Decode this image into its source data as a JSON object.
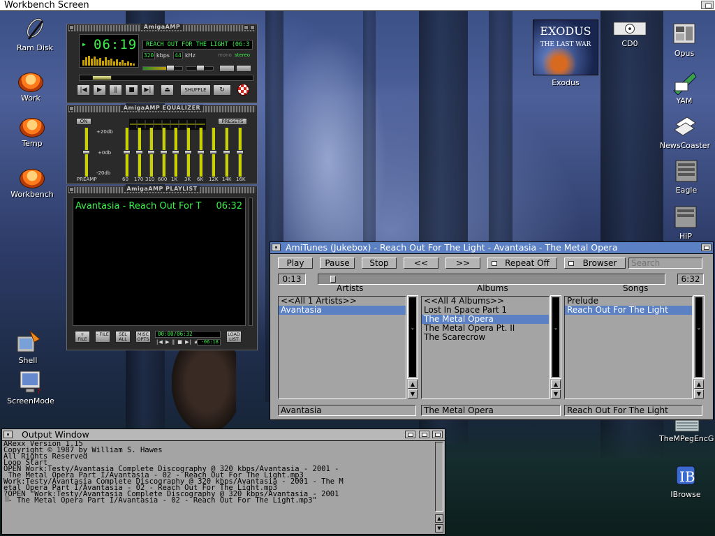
{
  "screen": {
    "title": "Workbench Screen"
  },
  "desktop_icons_left": [
    {
      "label": "Ram Disk",
      "icon": "ram-disk-icon"
    },
    {
      "label": "Work",
      "icon": "hard-disk-icon"
    },
    {
      "label": "Temp",
      "icon": "hard-disk-icon"
    },
    {
      "label": "Workbench",
      "icon": "hard-disk-icon"
    },
    {
      "label": "Shell",
      "icon": "shell-icon"
    },
    {
      "label": "ScreenMode",
      "icon": "screenmode-icon"
    }
  ],
  "desktop_icons_right": [
    {
      "label": "Exodus",
      "icon": "exodus-cover-icon"
    },
    {
      "label": "CD0",
      "icon": "cd-drive-icon"
    },
    {
      "label": "Opus",
      "icon": "opus-icon"
    },
    {
      "label": "YAM",
      "icon": "yam-mail-icon"
    },
    {
      "label": "NewsCoaster",
      "icon": "newscoaster-icon"
    },
    {
      "label": "Eagle",
      "icon": "eagle-icon"
    },
    {
      "label": "HiP",
      "icon": "hip-icon"
    },
    {
      "label": "TheMPegEncG",
      "icon": "mpeg-encoder-icon"
    },
    {
      "label": "IBrowse",
      "icon": "ibrowse-icon"
    }
  ],
  "exodus_cover": {
    "line1": "EXODUS",
    "line2": "THE LAST WAR"
  },
  "amigaamp": {
    "player_title": "AmigaAMP",
    "time": "06:19",
    "scroll_title": "REACH OUT FOR THE LIGHT (06:3",
    "kbps": "320",
    "kbps_unit": "kbps",
    "khz": "44",
    "khz_unit": "kHz",
    "mono": "mono",
    "stereo": "stereo",
    "shuffle": "SHUFFLE",
    "equalizer_title": "AmigaAMP EQUALIZER",
    "eq_on": "ON",
    "eq_presets": "PRESETS",
    "eq_db_top": "+20db",
    "eq_db_mid": "+0db",
    "eq_db_bottom": "-20db",
    "eq_bands": [
      "PREAMP",
      "60",
      "170",
      "310",
      "600",
      "1K",
      "3K",
      "6K",
      "12K",
      "14K",
      "16K"
    ],
    "eq_levels": [
      0.5,
      0.5,
      0.5,
      0.5,
      0.5,
      0.5,
      0.5,
      0.5,
      0.5,
      0.5,
      0.5
    ],
    "playlist_title": "AmigaAMP PLAYLIST",
    "playlist_entry": "Avantasia - Reach Out For T",
    "playlist_entry_time": "06:32",
    "pl_buttons": [
      "+ FILE",
      "- FILE",
      "SEL ALL",
      "MISC OPTS",
      "LOAD LIST"
    ],
    "pl_time": "00:00/06:32",
    "pl_remaining": "-06:18",
    "seek_progress": 0.08,
    "volume_level": 0.72,
    "balance_level": 0.5
  },
  "amitunes": {
    "title": "AmiTunes (Jukebox) - Reach Out For The Light - Avantasia - The Metal Opera",
    "buttons": {
      "play": "Play",
      "pause": "Pause",
      "stop": "Stop",
      "prev": "<<",
      "next": ">>",
      "repeat": "Repeat Off",
      "browser": "Browser"
    },
    "search_placeholder": "Search",
    "time_elapsed": "0:13",
    "time_total": "6:32",
    "progress": 0.03,
    "columns": {
      "artists": "Artists",
      "albums": "Albums",
      "songs": "Songs"
    },
    "artists": [
      "<<All 1 Artists>>",
      "Avantasia"
    ],
    "albums": [
      "<<All 4 Albums>>",
      "Lost In Space Part 1",
      "The Metal Opera",
      "The Metal Opera Pt. II",
      "The Scarecrow"
    ],
    "songs": [
      "Prelude",
      "Reach Out For The Light"
    ],
    "selected": {
      "artist": "Avantasia",
      "album": "The Metal Opera",
      "song": "Reach Out For The Light"
    }
  },
  "output": {
    "title": "Output Window",
    "lines": "ARexx Version 1.15\nCopyright © 1987 by William S. Hawes\nAll Rights Reserved\nLoop Start\nOPEN Work:Testy/Avantasia Complete Discography @ 320 kbps/Avantasia - 2001 -\n The Metal Opera Part I/Avantasia - 02 - Reach Out For The Light.mp3\nWork:Testy/Avantasia Complete Discography @ 320 kbps/Avantasia - 2001 - The M\netal Opera Part I/Avantasia - 02 - Reach Out For The Light.mp3\n?OPEN \"Work:Testy/Avantasia Complete Discography @ 320 kbps/Avantasia - 2001\n - The Metal Opera Part I/Avantasia - 02 - Reach Out For The Light.mp3\""
  }
}
